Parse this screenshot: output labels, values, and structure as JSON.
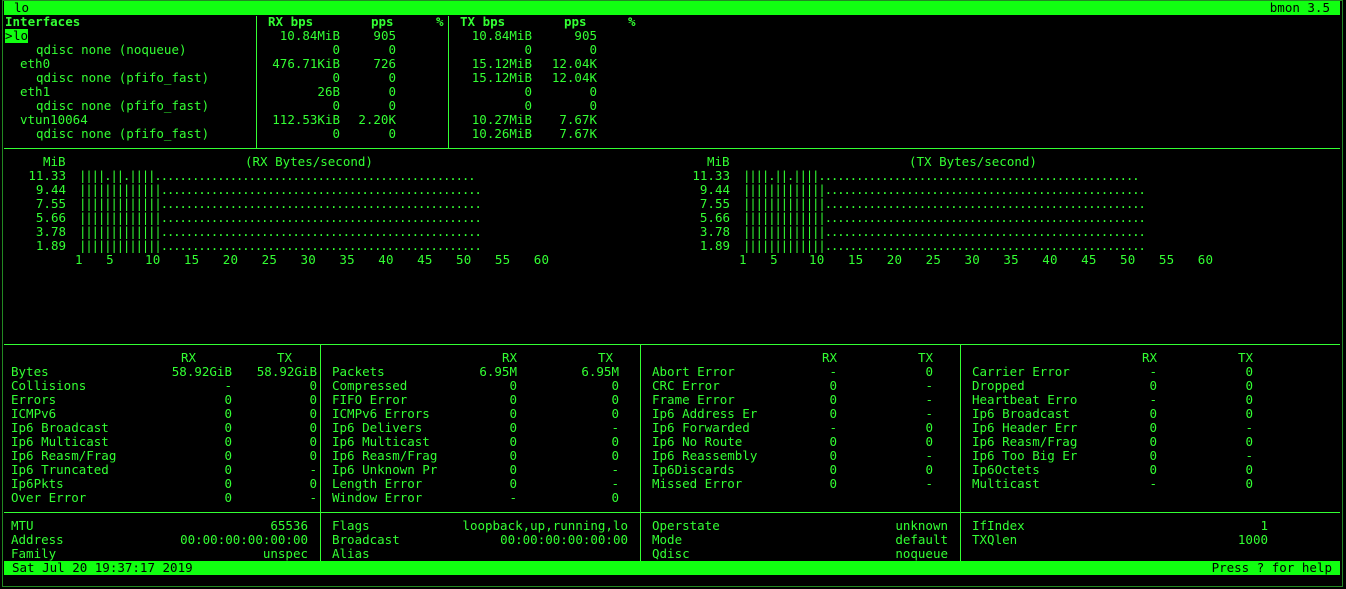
{
  "title_bar": {
    "left": "lo",
    "right": "bmon 3.5"
  },
  "interfaces": {
    "headers": {
      "name": "Interfaces",
      "rx_bps": "RX bps",
      "rx_pps": "pps",
      "rx_pct": "%",
      "tx_bps": "TX bps",
      "tx_pps": "pps",
      "tx_pct": "%"
    },
    "rows": [
      {
        "marker": ">",
        "name": "lo",
        "rx_bps": "10.84MiB",
        "rx_pps": "905",
        "tx_bps": "10.84MiB",
        "tx_pps": "905"
      },
      {
        "name": "qdisc none (noqueue)",
        "rx_bps": "0",
        "rx_pps": "0",
        "tx_bps": "0",
        "tx_pps": "0"
      },
      {
        "name": "eth0",
        "rx_bps": "476.71KiB",
        "rx_pps": "726",
        "tx_bps": "15.12MiB",
        "tx_pps": "12.04K"
      },
      {
        "name": "qdisc none (pfifo_fast)",
        "rx_bps": "0",
        "rx_pps": "0",
        "tx_bps": "15.12MiB",
        "tx_pps": "12.04K"
      },
      {
        "name": "eth1",
        "rx_bps": "26B",
        "rx_pps": "0",
        "tx_bps": "0",
        "tx_pps": "0"
      },
      {
        "name": "qdisc none (pfifo_fast)",
        "rx_bps": "0",
        "rx_pps": "0",
        "tx_bps": "0",
        "tx_pps": "0"
      },
      {
        "name": "vtun10064",
        "rx_bps": "112.53KiB",
        "rx_pps": "2.20K",
        "tx_bps": "10.27MiB",
        "tx_pps": "7.67K"
      },
      {
        "name": "qdisc none (pfifo_fast)",
        "rx_bps": "0",
        "rx_pps": "0",
        "tx_bps": "10.26MiB",
        "tx_pps": "7.67K"
      }
    ]
  },
  "graphs": [
    {
      "unit": "MiB",
      "title": "(RX Bytes/second)",
      "rows": [
        {
          "label": "11.33",
          "bars": "||||.||.||||..................................................."
        },
        {
          "label": "9.44",
          "bars": "|||||||||||||..................................................."
        },
        {
          "label": "7.55",
          "bars": "|||||||||||||..................................................."
        },
        {
          "label": "5.66",
          "bars": "|||||||||||||..................................................."
        },
        {
          "label": "3.78",
          "bars": "|||||||||||||..................................................."
        },
        {
          "label": "1.89",
          "bars": "|||||||||||||..................................................."
        }
      ],
      "xaxis": "1   5    10   15   20   25   30   35   40   45   50   55   60"
    },
    {
      "unit": "MiB",
      "title": "(TX Bytes/second)",
      "rows": [
        {
          "label": "11.33",
          "bars": "||||.||.||||..................................................."
        },
        {
          "label": "9.44",
          "bars": "|||||||||||||..................................................."
        },
        {
          "label": "7.55",
          "bars": "|||||||||||||..................................................."
        },
        {
          "label": "5.66",
          "bars": "|||||||||||||..................................................."
        },
        {
          "label": "3.78",
          "bars": "|||||||||||||..................................................."
        },
        {
          "label": "1.89",
          "bars": "|||||||||||||..................................................."
        }
      ],
      "xaxis": "1   5    10   15   20   25   30   35   40   45   50   55   60"
    }
  ],
  "stats": [
    {
      "rx_head": "RX",
      "tx_head": "TX",
      "rows": [
        [
          "Bytes",
          "58.92GiB",
          "58.92GiB"
        ],
        [
          "Collisions",
          "-",
          "0"
        ],
        [
          "Errors",
          "0",
          "0"
        ],
        [
          "ICMPv6",
          "0",
          "0"
        ],
        [
          "Ip6 Broadcast",
          "0",
          "0"
        ],
        [
          "Ip6 Multicast",
          "0",
          "0"
        ],
        [
          "Ip6 Reasm/Frag",
          "0",
          "0"
        ],
        [
          "Ip6 Truncated",
          "0",
          "-"
        ],
        [
          "Ip6Pkts",
          "0",
          "0"
        ],
        [
          "Over Error",
          "0",
          "-"
        ]
      ]
    },
    {
      "rx_head": "RX",
      "tx_head": "TX",
      "rows": [
        [
          "Packets",
          "6.95M",
          "6.95M"
        ],
        [
          "Compressed",
          "0",
          "0"
        ],
        [
          "FIFO Error",
          "0",
          "0"
        ],
        [
          "ICMPv6 Errors",
          "0",
          "0"
        ],
        [
          "Ip6 Delivers",
          "0",
          "-"
        ],
        [
          "Ip6 Multicast",
          "0",
          "0"
        ],
        [
          "Ip6 Reasm/Frag",
          "0",
          "0"
        ],
        [
          "Ip6 Unknown Pr",
          "0",
          "-"
        ],
        [
          "Length Error",
          "0",
          "-"
        ],
        [
          "Window Error",
          "-",
          "0"
        ]
      ]
    },
    {
      "rx_head": "RX",
      "tx_head": "TX",
      "rows": [
        [
          "Abort Error",
          "-",
          "0"
        ],
        [
          "CRC Error",
          "0",
          "-"
        ],
        [
          "Frame Error",
          "0",
          "-"
        ],
        [
          "Ip6 Address Er",
          "0",
          "-"
        ],
        [
          "Ip6 Forwarded",
          "-",
          "0"
        ],
        [
          "Ip6 No Route",
          "0",
          "0"
        ],
        [
          "Ip6 Reassembly",
          "0",
          "-"
        ],
        [
          "Ip6Discards",
          "0",
          "0"
        ],
        [
          "Missed Error",
          "0",
          "-"
        ]
      ]
    },
    {
      "rx_head": "RX",
      "tx_head": "TX",
      "rows": [
        [
          "Carrier Error",
          "-",
          "0"
        ],
        [
          "Dropped",
          "0",
          "0"
        ],
        [
          "Heartbeat Erro",
          "-",
          "0"
        ],
        [
          "Ip6 Broadcast",
          "0",
          "0"
        ],
        [
          "Ip6 Header Err",
          "0",
          "-"
        ],
        [
          "Ip6 Reasm/Frag",
          "0",
          "0"
        ],
        [
          "Ip6 Too Big Er",
          "0",
          "-"
        ],
        [
          "Ip6Octets",
          "0",
          "0"
        ],
        [
          "Multicast",
          "-",
          "0"
        ]
      ]
    }
  ],
  "info": [
    [
      [
        "MTU",
        "65536"
      ],
      [
        "Address",
        "00:00:00:00:00:00"
      ],
      [
        "Family",
        "unspec"
      ]
    ],
    [
      [
        "Flags",
        "loopback,up,running,lo"
      ],
      [
        "Broadcast",
        "00:00:00:00:00:00"
      ],
      [
        "Alias",
        ""
      ]
    ],
    [
      [
        "Operstate",
        "unknown"
      ],
      [
        "Mode",
        "default"
      ],
      [
        "Qdisc",
        "noqueue"
      ]
    ],
    [
      [
        "IfIndex",
        "1"
      ],
      [
        "TXQlen",
        "1000"
      ]
    ]
  ],
  "status_bar": {
    "left": "Sat Jul 20 19:37:17 2019",
    "right": "Press ? for help"
  }
}
